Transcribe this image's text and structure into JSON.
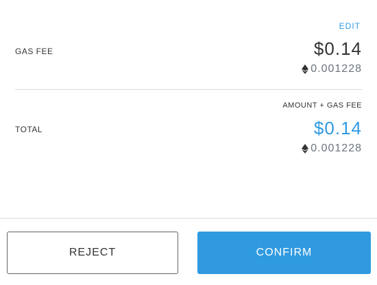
{
  "gas_fee": {
    "edit_label": "EDIT",
    "label": "GAS FEE",
    "fiat": "$0.14",
    "eth": "0.001228"
  },
  "total": {
    "caption": "AMOUNT + GAS FEE",
    "label": "TOTAL",
    "fiat": "$0.14",
    "eth": "0.001228"
  },
  "actions": {
    "reject_label": "REJECT",
    "confirm_label": "CONFIRM"
  },
  "colors": {
    "accent": "#2f9ae0",
    "text": "#333333",
    "muted": "#6a737d",
    "divider": "#d6d9dc"
  },
  "icons": {
    "currency": "eth-diamond-icon"
  }
}
